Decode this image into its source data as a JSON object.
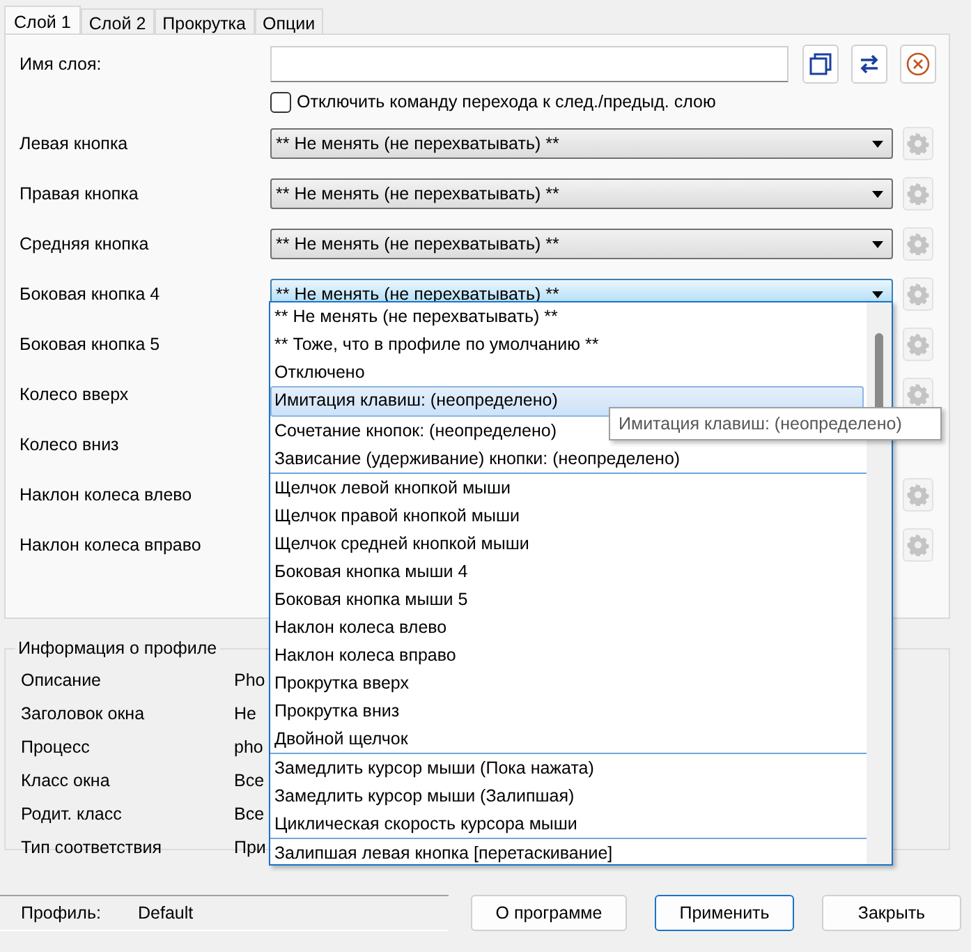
{
  "tabs": [
    {
      "label": "Слой 1",
      "selected": true
    },
    {
      "label": "Слой 2",
      "selected": false
    },
    {
      "label": "Прокрутка",
      "selected": false
    },
    {
      "label": "Опции",
      "selected": false
    }
  ],
  "layer_name": {
    "label": "Имя слоя:"
  },
  "disable_switch": {
    "label": "Отключить команду перехода к след./предыд. слою",
    "checked": false
  },
  "rows": [
    {
      "label": "Левая кнопка",
      "combo": {
        "value": "** Не менять (не перехватывать) **",
        "focused": false
      },
      "gear": true
    },
    {
      "label": "Правая кнопка",
      "combo": {
        "value": "** Не менять (не перехватывать) **",
        "focused": false
      },
      "gear": true
    },
    {
      "label": "Средняя кнопка",
      "combo": {
        "value": "** Не менять (не перехватывать) **",
        "focused": false
      },
      "gear": true
    },
    {
      "label": "Боковая кнопка 4",
      "combo": {
        "value": "** Не менять (не перехватывать) **",
        "focused": true
      },
      "gear": true
    },
    {
      "label": "Боковая кнопка 5",
      "gear": true
    },
    {
      "label": "Колесо вверх",
      "gear": true
    },
    {
      "label": "Колесо вниз",
      "gear": false
    },
    {
      "label": "Наклон колеса влево",
      "gear": true
    },
    {
      "label": "Наклон колеса вправо",
      "gear": true
    }
  ],
  "profile_info": {
    "title": "Информация о профиле",
    "rows": [
      {
        "label": "Описание",
        "value": "Pho"
      },
      {
        "label": "Заголовок окна",
        "value": "Не"
      },
      {
        "label": "Процесс",
        "value": "pho"
      },
      {
        "label": "Класс окна",
        "value": "Все"
      },
      {
        "label": "Родит. класс",
        "value": "Все"
      },
      {
        "label": "Тип соответствия",
        "value": "При"
      }
    ]
  },
  "status": {
    "label": "Профиль:",
    "value": "Default"
  },
  "buttons": [
    {
      "label": "О программе",
      "focused": false
    },
    {
      "label": "Применить",
      "focused": true
    },
    {
      "label": "Закрыть",
      "focused": false
    }
  ],
  "dropdown": {
    "groups": [
      [
        {
          "text": "** Не менять (не перехватывать) **",
          "selected": false
        },
        {
          "text": "** Тоже, что в профиле по умолчанию **",
          "selected": false
        },
        {
          "text": "Отключено",
          "selected": false
        },
        {
          "text": "Имитация клавиш: (неопределено)",
          "selected": true
        },
        {
          "text": "Сочетание кнопок: (неопределено)",
          "selected": false
        },
        {
          "text": "Зависание (удерживание) кнопки: (неопределено)",
          "selected": false
        }
      ],
      [
        {
          "text": "Щелчок левой кнопкой мыши",
          "selected": false
        },
        {
          "text": "Щелчок правой кнопкой мыши",
          "selected": false
        },
        {
          "text": "Щелчок средней кнопкой мыши",
          "selected": false
        },
        {
          "text": "Боковая кнопка мыши 4",
          "selected": false
        },
        {
          "text": "Боковая кнопка мыши 5",
          "selected": false
        },
        {
          "text": "Наклон колеса влево",
          "selected": false
        },
        {
          "text": "Наклон колеса вправо",
          "selected": false
        },
        {
          "text": "Прокрутка вверх",
          "selected": false
        },
        {
          "text": "Прокрутка вниз",
          "selected": false
        },
        {
          "text": "Двойной щелчок",
          "selected": false
        }
      ],
      [
        {
          "text": "Замедлить курсор мыши (Пока нажата)",
          "selected": false
        },
        {
          "text": "Замедлить курсор мыши (Залипшая)",
          "selected": false
        },
        {
          "text": "Циклическая скорость курсора мыши",
          "selected": false
        }
      ],
      [
        {
          "text": "Залипшая левая кнопка [перетаскивание]",
          "selected": false
        }
      ]
    ]
  },
  "tooltip": "Имитация клавиш: (неопределено)"
}
